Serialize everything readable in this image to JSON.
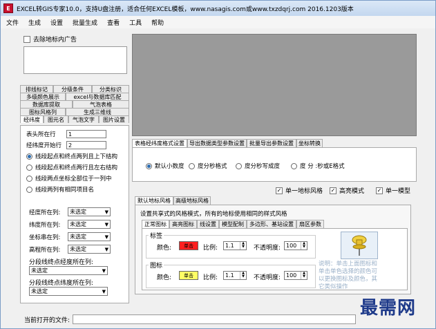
{
  "window": {
    "title": "EXCEL转GIS专家10.0，支持U盘注册，适合任何EXCEL模板，www.nasagis.com或www.txzdqrj.com 2016.1203版本",
    "icon_label": "E"
  },
  "menu": [
    "文件",
    "生成",
    "设置",
    "批量生成",
    "查看",
    "工具",
    "帮助"
  ],
  "left": {
    "remove_ad_label": "去除地标内广告",
    "tab_rows": [
      [
        "排线标记",
        "分级条件",
        "分类标识"
      ],
      [
        "多级颜色展示",
        "excel与数据库匹配"
      ],
      [
        "数据库提取",
        "气泡表格"
      ],
      [
        "图标风格列",
        "生成三维线"
      ],
      [
        "经纬度",
        "图元名",
        "气泡文字",
        "图片设置"
      ]
    ],
    "active_tab": "经纬度",
    "header_row_label": "表头所在行",
    "header_row_value": "1",
    "start_row_label": "经纬度开始行",
    "start_row_value": "2",
    "radios": [
      "线段起点和终点两列且上下结构",
      "线段起点和终点两行且左右结构",
      "线段两点坐标全部位于一列中",
      "线段两列有相同项目名"
    ],
    "radio_selected": 0,
    "selects": [
      {
        "label": "经度所在列:",
        "value": "未选定"
      },
      {
        "label": "纬度所在列:",
        "value": "未选定"
      },
      {
        "label": "坐标串在列:",
        "value": "未选定"
      },
      {
        "label": "高程所在列:",
        "value": "未选定"
      }
    ],
    "seg_lon_label": "分段线终点经度所在列:",
    "seg_lon_value": "未选定",
    "seg_lat_label": "分段线终点纬度所在列:",
    "seg_lat_value": "未选定"
  },
  "format": {
    "tabs": [
      "表格经纬度格式设置",
      "导出数据类型参数设置",
      "批量导出参数设置",
      "坐标转换"
    ],
    "active_tab": "表格经纬度格式设置",
    "radios": [
      "默认小数度",
      "度分秒格式",
      "度分秒写成度",
      "度 分 :秒或E格式"
    ],
    "radio_selected": 0
  },
  "options": [
    {
      "label": "单一地标风格",
      "checked": true
    },
    {
      "label": "高亮模式",
      "checked": true
    },
    {
      "label": "单一模型",
      "checked": true
    }
  ],
  "style": {
    "tabs": [
      "默认地标风格",
      "高级地标风格"
    ],
    "description": "设置共享式的风格模式，所有的地标使用相同的样式风格",
    "inner_tabs": [
      "正常图标",
      "高亮图标",
      "线设置",
      "模型配制",
      "多边形、基站设置",
      "扇区参数"
    ],
    "label_group": "标签",
    "icon_group": "图标",
    "color_label": "颜色:",
    "scale_label": "比例:",
    "opacity_label": "不透明度:",
    "label_color_btn": "单击",
    "icon_color_btn": "单击",
    "label_color": "#ff1f1f",
    "icon_color": "#ffff66",
    "label_scale": "1.1",
    "icon_scale": "1.1",
    "label_opacity": "100",
    "icon_opacity": "100",
    "note": "说明：单击上面图标和单击单色选择的颜色可以更换图标及颜色，其它类似操作",
    "pin_icon": "pushpin-icon"
  },
  "status": {
    "current_file_label": "当前打开的文件:"
  },
  "watermark": "最需网"
}
